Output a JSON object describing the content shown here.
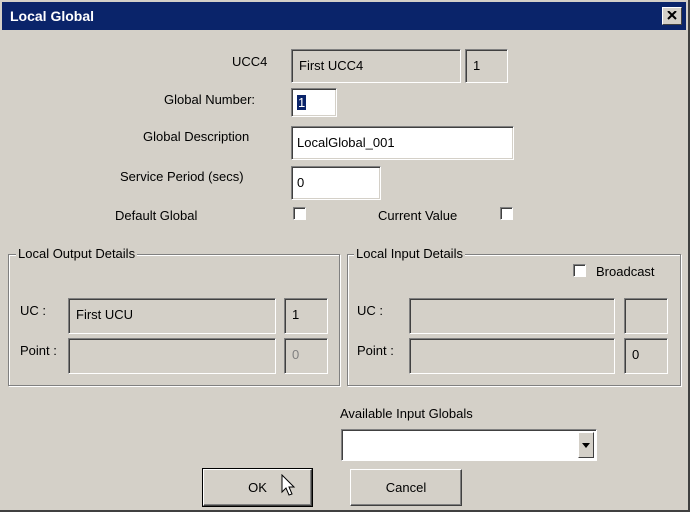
{
  "window": {
    "title": "Local Global",
    "close_icon": "close-icon"
  },
  "form": {
    "ucc4_label": "UCC4",
    "ucc4_name": "First UCC4",
    "ucc4_number": "1",
    "global_number_label": "Global Number:",
    "global_number_value": "1",
    "global_description_label": "Global Description",
    "global_description_value": "LocalGlobal_001",
    "service_period_label": "Service Period (secs)",
    "service_period_value": "0",
    "default_global_label": "Default Global",
    "default_global_checked": false,
    "current_value_label": "Current Value",
    "current_value_checked": false
  },
  "local_output": {
    "title": "Local Output Details",
    "uc_label": "UC :",
    "uc_name": "First UCU",
    "uc_number": "1",
    "point_label": "Point :",
    "point_name": "",
    "point_number": "0"
  },
  "local_input": {
    "title": "Local Input Details",
    "broadcast_label": "Broadcast",
    "broadcast_checked": false,
    "uc_label": "UC :",
    "uc_name": "",
    "uc_number": "",
    "point_label": "Point :",
    "point_name": "",
    "point_number": "0"
  },
  "available_inputs": {
    "label": "Available Input Globals",
    "selected": ""
  },
  "buttons": {
    "ok": "OK",
    "cancel": "Cancel"
  },
  "colors": {
    "titlebar": "#0a246a",
    "face": "#d4d0c8"
  }
}
